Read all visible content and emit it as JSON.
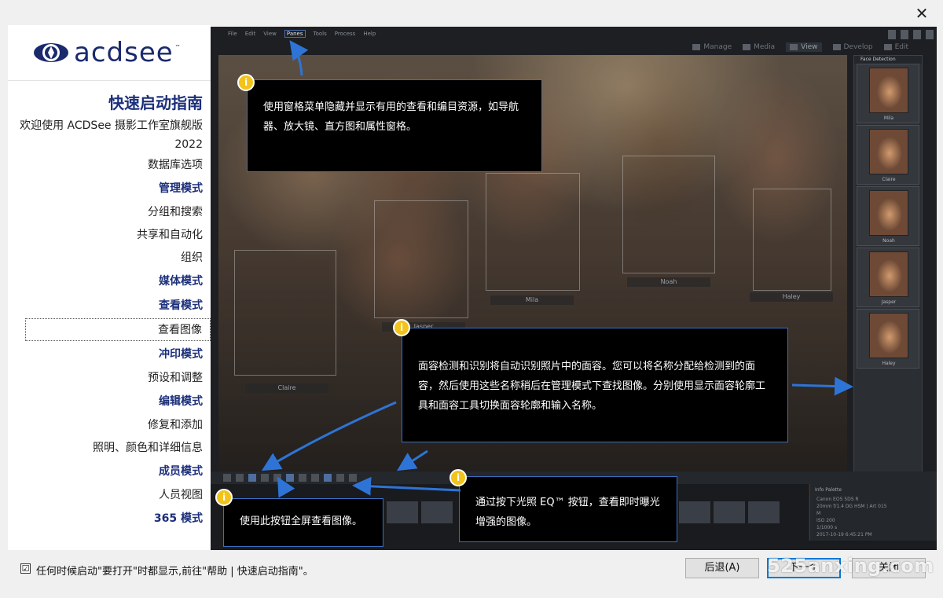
{
  "close_icon": "✕",
  "logo": {
    "text": "acdsee",
    "tm": "™"
  },
  "nav": {
    "title": "快速启动指南",
    "welcome": "欢迎使用 ACDSee 摄影工作室旗舰版 2022",
    "items": [
      {
        "label": "数据库选项",
        "kind": "item"
      },
      {
        "label": "管理模式",
        "kind": "head"
      },
      {
        "label": "分组和搜索",
        "kind": "item"
      },
      {
        "label": "共享和自动化",
        "kind": "item"
      },
      {
        "label": "组织",
        "kind": "item"
      },
      {
        "label": "媒体模式",
        "kind": "head"
      },
      {
        "label": "查看模式",
        "kind": "head"
      },
      {
        "label": "查看图像",
        "kind": "selected"
      },
      {
        "label": "冲印模式",
        "kind": "head"
      },
      {
        "label": "预设和调整",
        "kind": "item"
      },
      {
        "label": "编辑模式",
        "kind": "head"
      },
      {
        "label": "修复和添加",
        "kind": "item"
      },
      {
        "label": "照明、颜色和详细信息",
        "kind": "item"
      },
      {
        "label": "成员模式",
        "kind": "head"
      },
      {
        "label": "人员视图",
        "kind": "item"
      },
      {
        "label": "365 模式",
        "kind": "head"
      }
    ]
  },
  "app": {
    "menu": [
      "File",
      "Edit",
      "View",
      "Panes",
      "Tools",
      "Process",
      "Help"
    ],
    "modes": [
      "Manage",
      "Media",
      "View",
      "Develop",
      "Edit"
    ],
    "face_panel_title": "Face Detection",
    "faces": [
      "Mila",
      "Claire",
      "Noah",
      "Jasper",
      "Haley"
    ],
    "photo_labels": [
      "Jasper",
      "Mila",
      "Noah",
      "Haley",
      "Claire"
    ],
    "info_palette": {
      "title": "Info Palette",
      "lines": [
        "Canon EOS 5DS R",
        "20mm f/1.4 DG HSM | Art 015",
        "M",
        "ISO 200",
        "1/1000 s",
        "2017-10-19 6:45:21 PM"
      ]
    }
  },
  "callouts": {
    "panes": "使用窗格菜单隐藏并显示有用的查看和编目资源，如导航器、放大镜、直方图和属性窗格。",
    "faces": "面容检测和识别将自动识别照片中的面容。您可以将名称分配给检测到的面容，然后使用这些名称稍后在管理模式下查找图像。分别使用显示面容轮廓工具和面容工具切换面容轮廓和输入名称。",
    "fullscreen": "使用此按钮全屏查看图像。",
    "eq": "通过按下光照 EQ™ 按钮，查看即时曝光增强的图像。",
    "badge": "i"
  },
  "footer": {
    "checkbox_mark": "☑",
    "checkbox_label": "任何时候启动\"要打开\"时都显示,前往\"帮助 | 快速启动指南\"。",
    "back": "后退(A)",
    "next": "下一个",
    "close": "关闭",
    "watermark": "525anxing.com"
  }
}
